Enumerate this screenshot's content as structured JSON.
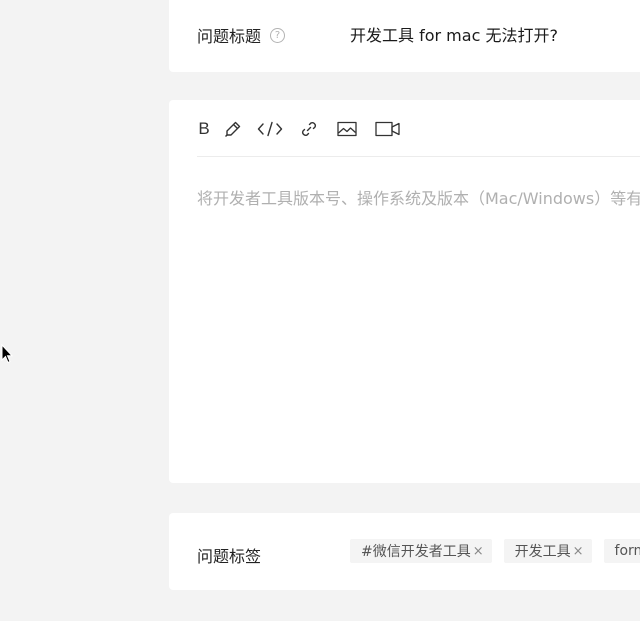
{
  "question": {
    "title_label": "问题标题",
    "help_icon_glyph": "?",
    "title_value": "开发工具 for mac 无法打开?"
  },
  "editor": {
    "toolbar": {
      "bold_label": "B",
      "icons": [
        "pencil-icon",
        "code-icon",
        "link-icon",
        "image-icon",
        "video-icon"
      ]
    },
    "placeholder": "将开发者工具版本号、操作系统及版本（Mac/Windows）等有"
  },
  "tags": {
    "label": "问题标签",
    "items": [
      {
        "text": "#微信开发者工具",
        "remove": "×"
      },
      {
        "text": "开发工具",
        "remove": "×"
      },
      {
        "text": "form",
        "remove": ""
      }
    ]
  }
}
